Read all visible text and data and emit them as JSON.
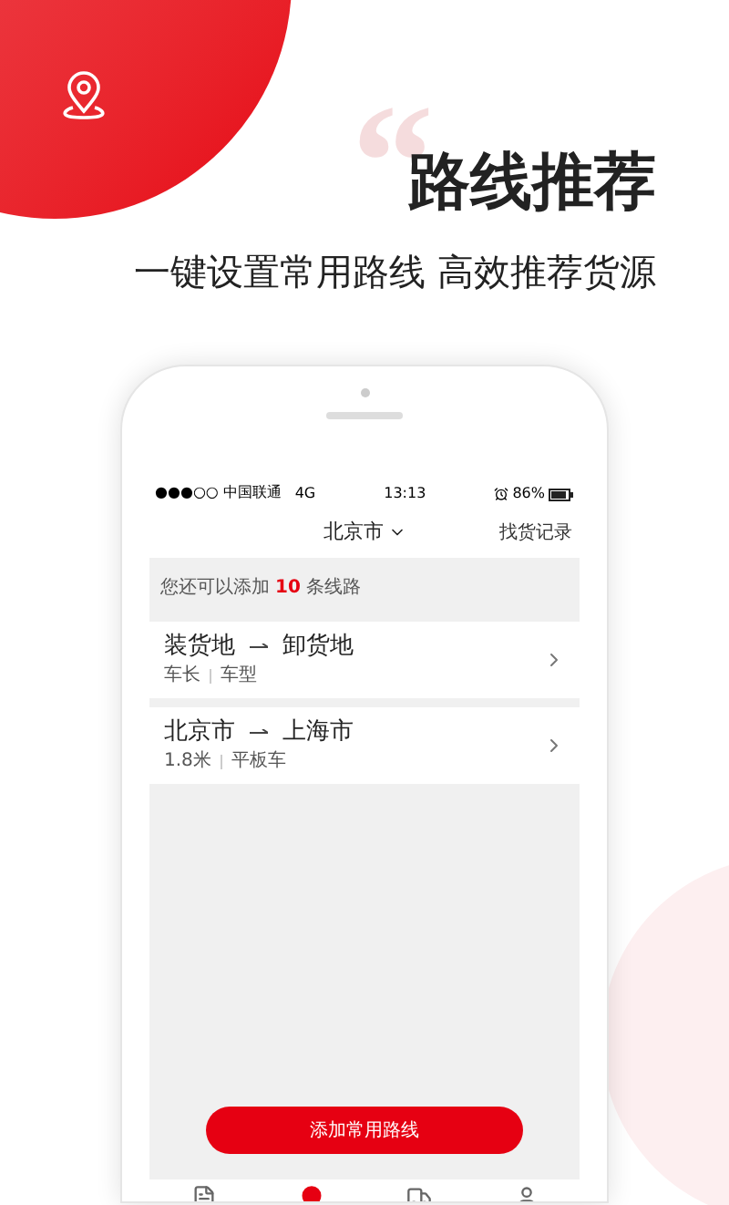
{
  "headline": {
    "quote_mark": "“",
    "title": "路线推荐",
    "subtitle": "一键设置常用路线 高效推荐货源"
  },
  "status_bar": {
    "carrier": "●●●○○ 中国联通",
    "network": "4G",
    "time": "13:13",
    "battery": "86%"
  },
  "nav": {
    "city": "北京市",
    "history_link": "找货记录"
  },
  "quota": {
    "prefix": "您还可以添加",
    "count": "10",
    "suffix": "条线路"
  },
  "routes": [
    {
      "from": "装货地",
      "to": "卸货地",
      "tags": [
        "车长",
        "车型"
      ]
    },
    {
      "from": "北京市",
      "to": "上海市",
      "tags": [
        "1.8米",
        "平板车"
      ]
    }
  ],
  "add_button": "添加常用路线",
  "tabs": [
    {
      "kind": "list",
      "selected": false
    },
    {
      "kind": "pin",
      "selected": true
    },
    {
      "kind": "truck",
      "selected": false
    },
    {
      "kind": "person",
      "selected": false
    }
  ]
}
